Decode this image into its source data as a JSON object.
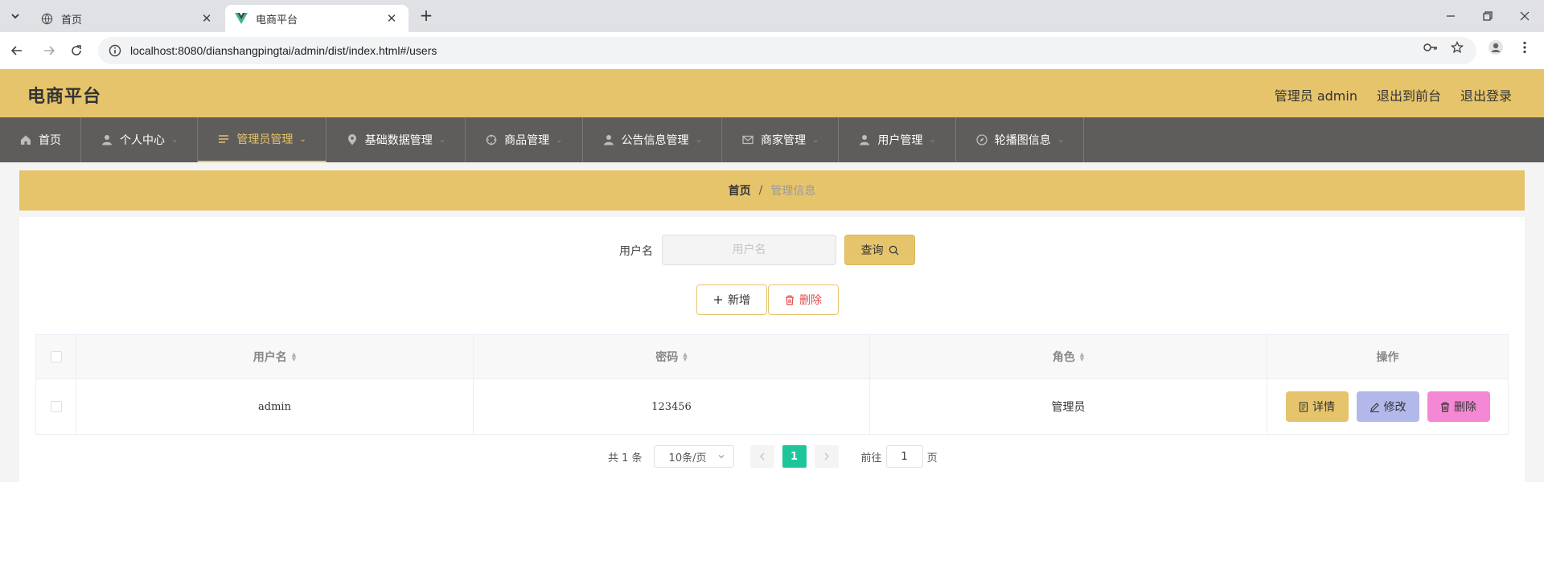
{
  "browser": {
    "tabs": [
      {
        "title": "首页",
        "active": false
      },
      {
        "title": "电商平台",
        "active": true
      }
    ],
    "new_tab": "+",
    "url": "localhost:8080/dianshangpingtai/admin/dist/index.html#/users",
    "window_controls": [
      "minimize",
      "restore",
      "close"
    ]
  },
  "header": {
    "logo": "电商平台",
    "user": "管理员 admin",
    "back_to_front": "退出到前台",
    "logout": "退出登录",
    "accent_color": "#e6c46c"
  },
  "nav": {
    "items": [
      {
        "label": "首页",
        "icon": "home-icon",
        "dropdown": false,
        "active": false
      },
      {
        "label": "个人中心",
        "icon": "person-icon",
        "dropdown": true,
        "active": false
      },
      {
        "label": "管理员管理",
        "icon": "menu-lines-icon",
        "dropdown": true,
        "active": true
      },
      {
        "label": "基础数据管理",
        "icon": "location-pin-icon",
        "dropdown": true,
        "active": false
      },
      {
        "label": "商品管理",
        "icon": "crosshair-icon",
        "dropdown": true,
        "active": false
      },
      {
        "label": "公告信息管理",
        "icon": "person-icon",
        "dropdown": true,
        "active": false
      },
      {
        "label": "商家管理",
        "icon": "mail-icon",
        "dropdown": true,
        "active": false
      },
      {
        "label": "用户管理",
        "icon": "person-icon",
        "dropdown": true,
        "active": false
      },
      {
        "label": "轮播图信息",
        "icon": "compass-icon",
        "dropdown": true,
        "active": false
      }
    ]
  },
  "breadcrumb": {
    "home": "首页",
    "separator": "/",
    "current": "管理信息"
  },
  "search": {
    "label": "用户名",
    "placeholder": "用户名",
    "value": "",
    "query_label": "查询"
  },
  "actions": {
    "add_label": "新增",
    "delete_label": "删除"
  },
  "table": {
    "columns": [
      "用户名",
      "密码",
      "角色",
      "操作"
    ],
    "rows": [
      {
        "username": "admin",
        "password": "123456",
        "role": "管理员"
      }
    ],
    "row_actions": {
      "detail": "详情",
      "edit": "修改",
      "delete": "删除"
    }
  },
  "pagination": {
    "total": "共 1 条",
    "page_size": "10条/页",
    "current_page": "1",
    "goto_label": "前往",
    "goto_value": "1",
    "page_suffix": "页"
  }
}
